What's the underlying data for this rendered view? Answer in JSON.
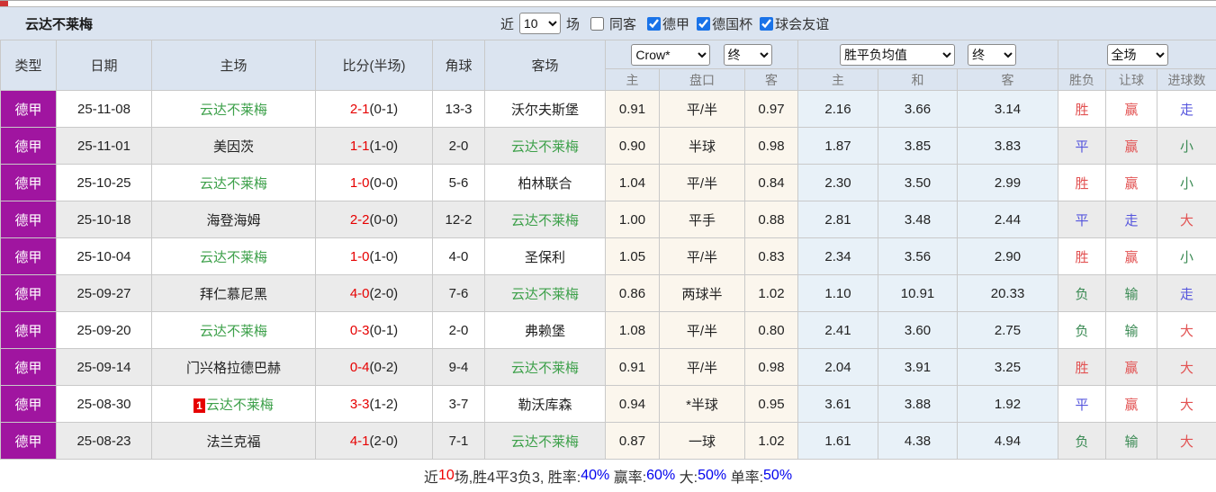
{
  "page": {
    "title": "云达不莱梅",
    "filters": {
      "recent_label": "近",
      "recent_count": "10",
      "unit_label": "场",
      "same_opponent_label": "同客",
      "same_opponent_checked": false,
      "leagues": [
        {
          "label": "德甲",
          "checked": true
        },
        {
          "label": "德国杯",
          "checked": true
        },
        {
          "label": "球会友谊",
          "checked": true
        }
      ]
    }
  },
  "table": {
    "selects": {
      "bookmaker": "Crow*",
      "bookmaker_stage": "终",
      "average": "胜平负均值",
      "average_stage": "终",
      "scope": "全场"
    },
    "headers": {
      "type": "类型",
      "date": "日期",
      "home": "主场",
      "score": "比分(半场)",
      "corner": "角球",
      "away": "客场",
      "sub": [
        "主",
        "盘口",
        "客",
        "主",
        "和",
        "客",
        "胜负",
        "让球",
        "进球数"
      ]
    },
    "rows": [
      {
        "league": "德甲",
        "date": "25-11-08",
        "home": "云达不莱梅",
        "home_self": true,
        "home_badge": "",
        "score_ft": "2-1",
        "score_ht": "(0-1)",
        "corner": "13-3",
        "away": "沃尔夫斯堡",
        "away_self": false,
        "odds": [
          "0.91",
          "平/半",
          "0.97"
        ],
        "avg": [
          "2.16",
          "3.66",
          "3.14"
        ],
        "outcomes": [
          {
            "text": "胜",
            "color": "red"
          },
          {
            "text": "赢",
            "color": "red"
          },
          {
            "text": "走",
            "color": "blue"
          }
        ]
      },
      {
        "league": "德甲",
        "date": "25-11-01",
        "home": "美因茨",
        "home_self": false,
        "home_badge": "",
        "score_ft": "1-1",
        "score_ht": "(1-0)",
        "corner": "2-0",
        "away": "云达不莱梅",
        "away_self": true,
        "odds": [
          "0.90",
          "半球",
          "0.98"
        ],
        "avg": [
          "1.87",
          "3.85",
          "3.83"
        ],
        "outcomes": [
          {
            "text": "平",
            "color": "blue"
          },
          {
            "text": "赢",
            "color": "red"
          },
          {
            "text": "小",
            "color": "green"
          }
        ]
      },
      {
        "league": "德甲",
        "date": "25-10-25",
        "home": "云达不莱梅",
        "home_self": true,
        "home_badge": "",
        "score_ft": "1-0",
        "score_ht": "(0-0)",
        "corner": "5-6",
        "away": "柏林联合",
        "away_self": false,
        "odds": [
          "1.04",
          "平/半",
          "0.84"
        ],
        "avg": [
          "2.30",
          "3.50",
          "2.99"
        ],
        "outcomes": [
          {
            "text": "胜",
            "color": "red"
          },
          {
            "text": "赢",
            "color": "red"
          },
          {
            "text": "小",
            "color": "green"
          }
        ]
      },
      {
        "league": "德甲",
        "date": "25-10-18",
        "home": "海登海姆",
        "home_self": false,
        "home_badge": "",
        "score_ft": "2-2",
        "score_ht": "(0-0)",
        "corner": "12-2",
        "away": "云达不莱梅",
        "away_self": true,
        "odds": [
          "1.00",
          "平手",
          "0.88"
        ],
        "avg": [
          "2.81",
          "3.48",
          "2.44"
        ],
        "outcomes": [
          {
            "text": "平",
            "color": "blue"
          },
          {
            "text": "走",
            "color": "blue"
          },
          {
            "text": "大",
            "color": "red"
          }
        ]
      },
      {
        "league": "德甲",
        "date": "25-10-04",
        "home": "云达不莱梅",
        "home_self": true,
        "home_badge": "",
        "score_ft": "1-0",
        "score_ht": "(1-0)",
        "corner": "4-0",
        "away": "圣保利",
        "away_self": false,
        "odds": [
          "1.05",
          "平/半",
          "0.83"
        ],
        "avg": [
          "2.34",
          "3.56",
          "2.90"
        ],
        "outcomes": [
          {
            "text": "胜",
            "color": "red"
          },
          {
            "text": "赢",
            "color": "red"
          },
          {
            "text": "小",
            "color": "green"
          }
        ]
      },
      {
        "league": "德甲",
        "date": "25-09-27",
        "home": "拜仁慕尼黑",
        "home_self": false,
        "home_badge": "",
        "score_ft": "4-0",
        "score_ht": "(2-0)",
        "corner": "7-6",
        "away": "云达不莱梅",
        "away_self": true,
        "odds": [
          "0.86",
          "两球半",
          "1.02"
        ],
        "avg": [
          "1.10",
          "10.91",
          "20.33"
        ],
        "outcomes": [
          {
            "text": "负",
            "color": "green"
          },
          {
            "text": "输",
            "color": "green"
          },
          {
            "text": "走",
            "color": "blue"
          }
        ]
      },
      {
        "league": "德甲",
        "date": "25-09-20",
        "home": "云达不莱梅",
        "home_self": true,
        "home_badge": "",
        "score_ft": "0-3",
        "score_ht": "(0-1)",
        "corner": "2-0",
        "away": "弗赖堡",
        "away_self": false,
        "odds": [
          "1.08",
          "平/半",
          "0.80"
        ],
        "avg": [
          "2.41",
          "3.60",
          "2.75"
        ],
        "outcomes": [
          {
            "text": "负",
            "color": "green"
          },
          {
            "text": "输",
            "color": "green"
          },
          {
            "text": "大",
            "color": "red"
          }
        ]
      },
      {
        "league": "德甲",
        "date": "25-09-14",
        "home": "门兴格拉德巴赫",
        "home_self": false,
        "home_badge": "",
        "score_ft": "0-4",
        "score_ht": "(0-2)",
        "corner": "9-4",
        "away": "云达不莱梅",
        "away_self": true,
        "odds": [
          "0.91",
          "平/半",
          "0.98"
        ],
        "avg": [
          "2.04",
          "3.91",
          "3.25"
        ],
        "outcomes": [
          {
            "text": "胜",
            "color": "red"
          },
          {
            "text": "赢",
            "color": "red"
          },
          {
            "text": "大",
            "color": "red"
          }
        ]
      },
      {
        "league": "德甲",
        "date": "25-08-30",
        "home": "云达不莱梅",
        "home_self": true,
        "home_badge": "1",
        "score_ft": "3-3",
        "score_ht": "(1-2)",
        "corner": "3-7",
        "away": "勒沃库森",
        "away_self": false,
        "odds": [
          "0.94",
          "*半球",
          "0.95"
        ],
        "avg": [
          "3.61",
          "3.88",
          "1.92"
        ],
        "outcomes": [
          {
            "text": "平",
            "color": "blue"
          },
          {
            "text": "赢",
            "color": "red"
          },
          {
            "text": "大",
            "color": "red"
          }
        ]
      },
      {
        "league": "德甲",
        "date": "25-08-23",
        "home": "法兰克福",
        "home_self": false,
        "home_badge": "",
        "score_ft": "4-1",
        "score_ht": "(2-0)",
        "corner": "7-1",
        "away": "云达不莱梅",
        "away_self": true,
        "odds": [
          "0.87",
          "一球",
          "1.02"
        ],
        "avg": [
          "1.61",
          "4.38",
          "4.94"
        ],
        "outcomes": [
          {
            "text": "负",
            "color": "green"
          },
          {
            "text": "输",
            "color": "green"
          },
          {
            "text": "大",
            "color": "red"
          }
        ]
      }
    ]
  },
  "footer": {
    "segments": [
      {
        "text": "近",
        "color": "dark"
      },
      {
        "text": "10",
        "color": "red"
      },
      {
        "text": "场,胜4平3负3, 胜率:",
        "color": "dark"
      },
      {
        "text": "40%",
        "color": "blue"
      },
      {
        "text": " 赢率:",
        "color": "dark"
      },
      {
        "text": "60%",
        "color": "blue"
      },
      {
        "text": " 大:",
        "color": "dark"
      },
      {
        "text": "50%",
        "color": "blue"
      },
      {
        "text": " 单率:",
        "color": "dark"
      },
      {
        "text": "50%",
        "color": "blue"
      }
    ]
  },
  "colors": {
    "header_bg": "#dbe4f0",
    "league_badge_bg": "#a015a0",
    "self_team_green": "#3da04a",
    "score_red": "#e60000",
    "win_red": "#e25252",
    "draw_blue": "#5555dd",
    "lose_green": "#3c8b55",
    "odds_cream_bg": "#fbf6ed",
    "odds_blue_bg": "#e8f1f8",
    "stripe_gray": "#ebebeb",
    "footer_blue": "#0000ee",
    "footer_red": "#ee0000"
  }
}
